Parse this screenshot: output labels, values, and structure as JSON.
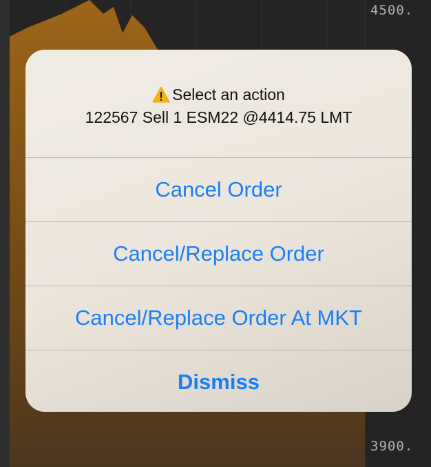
{
  "chart": {
    "price_top": "4500.",
    "price_bottom": "3900.",
    "area_color": "#b8741a"
  },
  "alert": {
    "warning_icon": "warning-triangle-icon",
    "title": "Select an action",
    "message": "122567 Sell 1 ESM22 @4414.75 LMT",
    "buttons": [
      {
        "label": "Cancel Order",
        "bold": false
      },
      {
        "label": "Cancel/Replace Order",
        "bold": false
      },
      {
        "label": "Cancel/Replace Order At MKT",
        "bold": false
      },
      {
        "label": "Dismiss",
        "bold": true
      }
    ],
    "accent_color": "#1a7ff5"
  }
}
